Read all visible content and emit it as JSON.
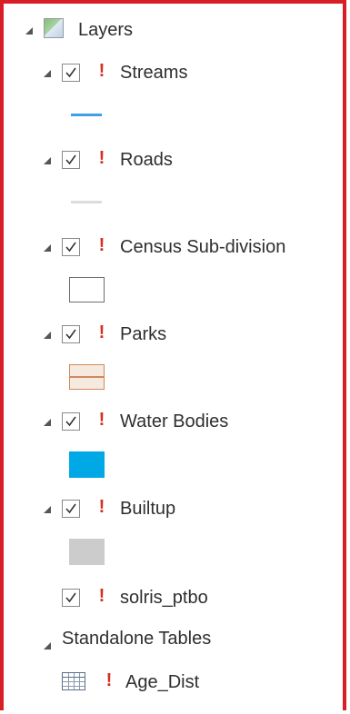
{
  "root": {
    "label": "Layers"
  },
  "layers": [
    {
      "label": "Streams",
      "checked": true,
      "warning": "!"
    },
    {
      "label": "Roads",
      "checked": true,
      "warning": "!"
    },
    {
      "label": "Census Sub-division",
      "checked": true,
      "warning": "!"
    },
    {
      "label": "Parks",
      "checked": true,
      "warning": "!"
    },
    {
      "label": "Water Bodies",
      "checked": true,
      "warning": "!"
    },
    {
      "label": "Builtup",
      "checked": true,
      "warning": "!"
    },
    {
      "label": "solris_ptbo",
      "checked": true,
      "warning": "!"
    }
  ],
  "tables_group": {
    "label": "Standalone Tables"
  },
  "tables": [
    {
      "label": "Age_Dist",
      "warning": "!"
    }
  ],
  "colors": {
    "frame": "#d91f26",
    "warning": "#d62f20",
    "streams_line": "#3fa0e6",
    "roads_line": "#dcdcdc",
    "census_fill": "#ffffff",
    "census_outline": "#6e6e6e",
    "parks_outline": "#d08a5c",
    "parks_fill": "#f6e9e0",
    "water_fill": "#00a9e6",
    "builtup_fill": "#cccccc"
  }
}
